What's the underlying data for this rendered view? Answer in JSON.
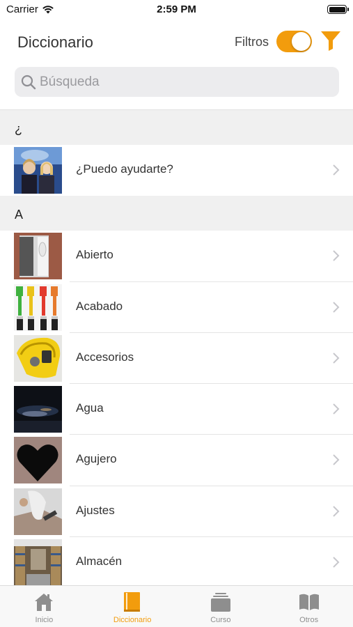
{
  "status_bar": {
    "carrier": "Carrier",
    "time": "2:59 PM"
  },
  "header": {
    "title": "Diccionario",
    "filter_label": "Filtros",
    "filter_toggle_on": true,
    "accent_color": "#f29c0d"
  },
  "search": {
    "placeholder": "Búsqueda",
    "value": ""
  },
  "sections": [
    {
      "header": "¿",
      "items": [
        {
          "label": "¿Puedo ayudarte?",
          "thumb": "help-desk-photo"
        }
      ]
    },
    {
      "header": "A",
      "items": [
        {
          "label": "Abierto",
          "thumb": "open-door-photo"
        },
        {
          "label": "Acabado",
          "thumb": "paint-brushes-photo"
        },
        {
          "label": "Accesorios",
          "thumb": "yellow-accessory-photo"
        },
        {
          "label": "Agua",
          "thumb": "water-photo"
        },
        {
          "label": "Agujero",
          "thumb": "heart-hole-photo"
        },
        {
          "label": "Ajustes",
          "thumb": "adjusting-photo"
        },
        {
          "label": "Almacén",
          "thumb": "warehouse-photo"
        }
      ]
    }
  ],
  "tab_bar": {
    "tabs": [
      {
        "label": "Inicio",
        "icon": "home-icon",
        "active": false
      },
      {
        "label": "Diccionario",
        "icon": "book-icon",
        "active": true
      },
      {
        "label": "Curso",
        "icon": "stack-icon",
        "active": false
      },
      {
        "label": "Otros",
        "icon": "open-book-icon",
        "active": false
      }
    ]
  }
}
